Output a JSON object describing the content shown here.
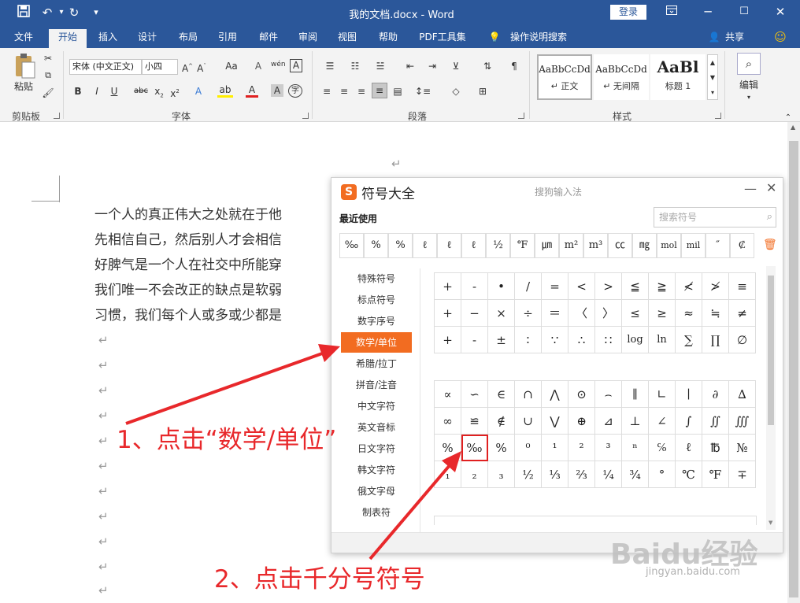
{
  "window": {
    "title": "我的文档.docx - Word",
    "login_label": "登录"
  },
  "tabs": [
    "文件",
    "开始",
    "插入",
    "设计",
    "布局",
    "引用",
    "邮件",
    "审阅",
    "视图",
    "帮助",
    "PDF工具集",
    "操作说明搜索"
  ],
  "share_label": "共享",
  "ribbon": {
    "paste_label": "粘贴",
    "clipboard_label": "剪贴板",
    "font_label": "字体",
    "paragraph_label": "段落",
    "styles_label": "样式",
    "editing_label": "编辑",
    "font_name": "宋体 (中文正文)",
    "font_size": "小四",
    "font_buttons": [
      "Aˆ",
      "Aˇ",
      "Aa",
      "A",
      "B",
      "I",
      "U",
      "abc",
      "x₂",
      "x²",
      "A",
      "A"
    ],
    "styles": [
      {
        "preview": "AaBbCcDd",
        "name": "↵ 正文"
      },
      {
        "preview": "AaBbCcDd",
        "name": "↵ 无间隔"
      },
      {
        "preview": "AaBl",
        "name": "标题 1"
      }
    ]
  },
  "document": {
    "paragraphs": [
      "一个人的真正伟大之处就在于他",
      "先相信自己，然后别人才会相信",
      "好脾气是一个人在社交中所能穿",
      "我们唯一不会改正的缺点是软弱",
      "习惯，我们每个人或多或少都是"
    ],
    "pilcrow": "↵"
  },
  "panel": {
    "title": "符号大全",
    "subtitle": "搜狗输入法",
    "recent_label": "最近使用",
    "search_placeholder": "搜索符号",
    "recent": [
      "‰",
      "%",
      "%",
      "ℓ",
      "ℓ",
      "ℓ",
      "½",
      "℉",
      "㎛",
      "m²",
      "m³",
      "㏄",
      "㎎",
      "mol",
      "mil",
      "″",
      "₡"
    ],
    "categories": [
      "特殊符号",
      "标点符号",
      "数字序号",
      "数学/单位",
      "希腊/拉丁",
      "拼音/注音",
      "中文字符",
      "英文音标",
      "日文字符",
      "韩文字符",
      "俄文字母",
      "制表符"
    ],
    "active_category": "数学/单位",
    "grid1": [
      [
        "+",
        "-",
        "•",
        "/",
        "=",
        "<",
        ">",
        "≦",
        "≧",
        "≮",
        "≯",
        "≡"
      ],
      [
        "+",
        "−",
        "×",
        "÷",
        "＝",
        "〈",
        "〉",
        "≤",
        "≥",
        "≈",
        "≒",
        "≠"
      ],
      [
        "+",
        "-",
        "±",
        "∶",
        "∵",
        "∴",
        "∷",
        "log",
        "ln",
        "∑",
        "∏",
        "∅"
      ]
    ],
    "grid2": [
      [
        "∝",
        "∽",
        "∈",
        "∩",
        "⋀",
        "⊙",
        "⌢",
        "∥",
        "∟",
        "∣",
        "∂",
        "∆"
      ],
      [
        "∞",
        "≌",
        "∉",
        "∪",
        "⋁",
        "⊕",
        "⊿",
        "⊥",
        "∠",
        "∫",
        "∬",
        "∭"
      ],
      [
        "%",
        "‰",
        "%",
        "⁰",
        "¹",
        "²",
        "³",
        "ⁿ",
        "℅",
        "ℓ",
        "℔",
        "№"
      ],
      [
        "₁",
        "₂",
        "₃",
        "½",
        "⅓",
        "⅔",
        "¼",
        "¾",
        "°",
        "℃",
        "℉",
        "∓"
      ]
    ]
  },
  "annotations": {
    "step1": "1、点击“数学/单位”",
    "step2": "2、点击千分号符号"
  },
  "watermark": {
    "logo": "Baidu经验",
    "url": "jingyan.baidu.com"
  },
  "colors": {
    "accent": "#2b579a",
    "sogou": "#f26c21",
    "annotation": "#e8282b"
  }
}
